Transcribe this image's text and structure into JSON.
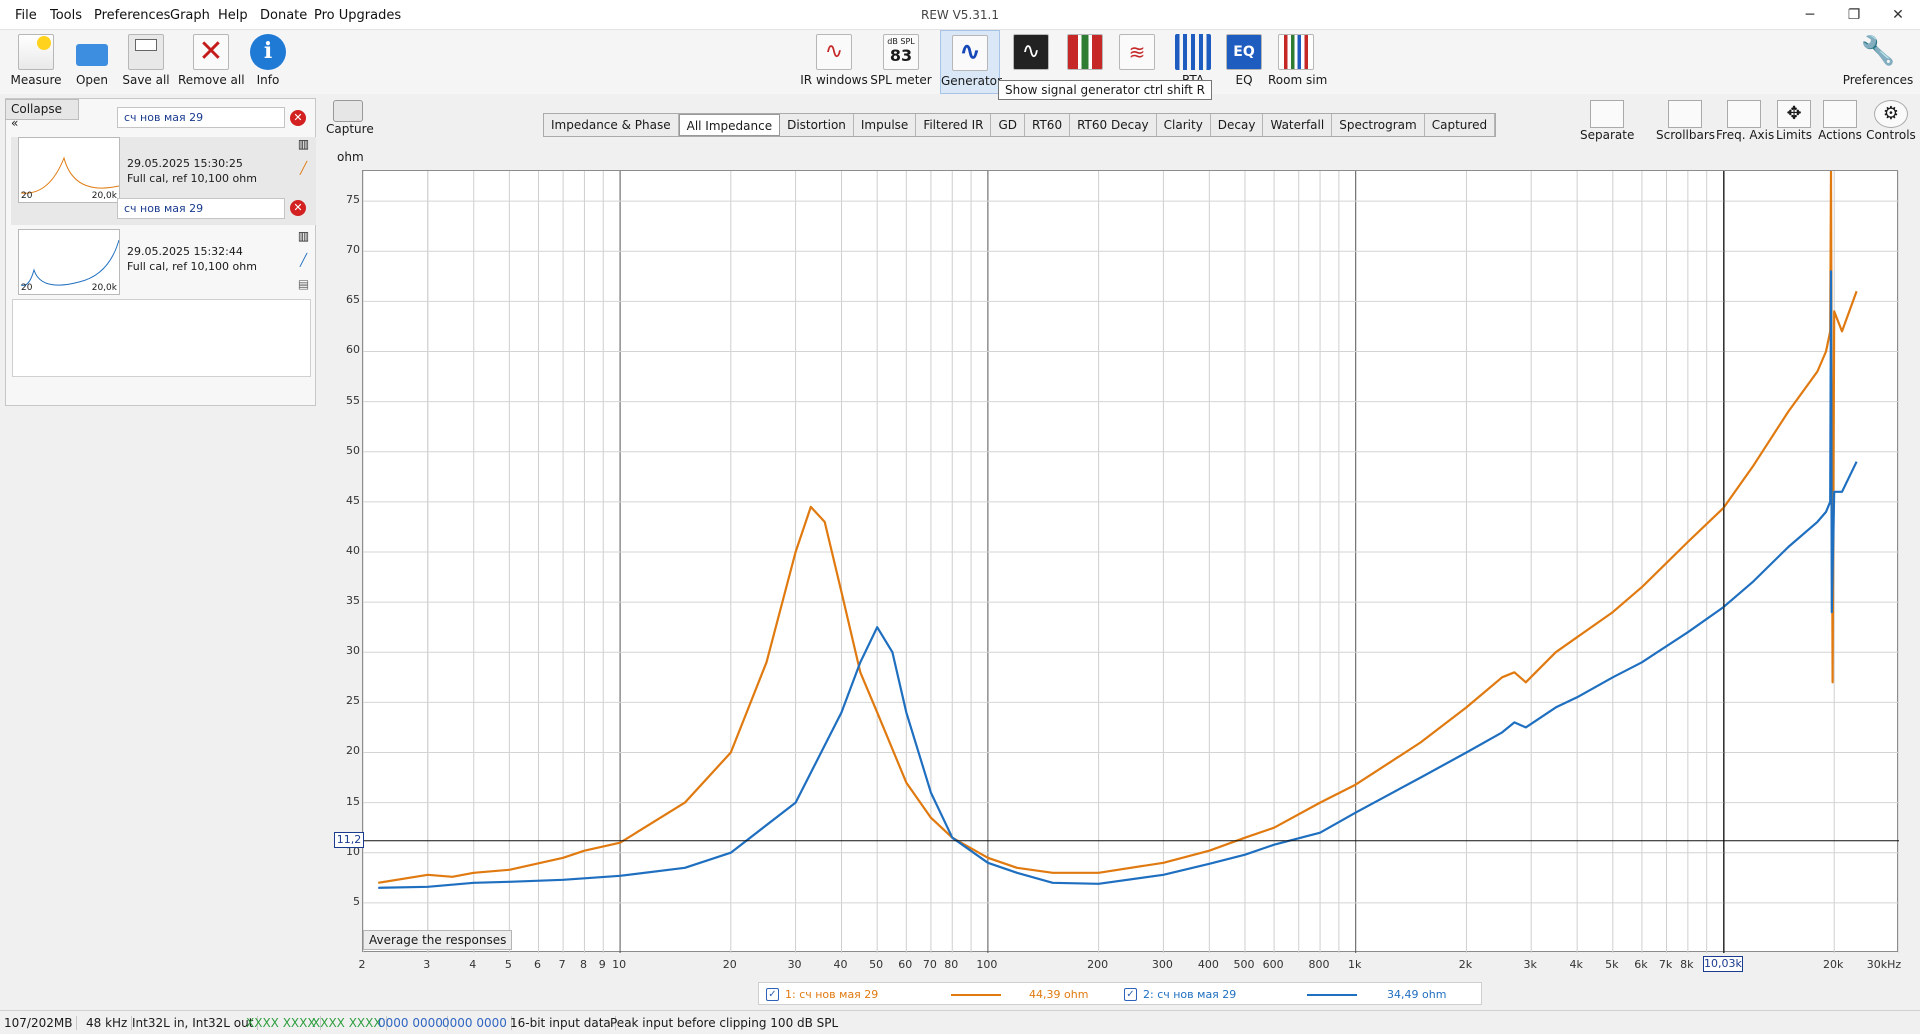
{
  "window": {
    "title": "REW V5.31.1",
    "menu": [
      "File",
      "Tools",
      "Preferences",
      "Graph",
      "Help",
      "Donate",
      "Pro Upgrades"
    ],
    "controls": {
      "minimize": "─",
      "maximize": "❐",
      "close": "✕"
    }
  },
  "toolbar": {
    "left": [
      {
        "label": "Measure",
        "icon": "measure-icon"
      },
      {
        "label": "Open",
        "icon": "folder-icon"
      },
      {
        "label": "Save all",
        "icon": "save-icon"
      },
      {
        "label": "Remove all",
        "icon": "remove-icon"
      },
      {
        "label": "Info",
        "icon": "info-icon"
      }
    ],
    "center": [
      {
        "label": "IR windows",
        "icon": "ir-windows-icon"
      },
      {
        "label": "SPL meter",
        "icon": "spl-meter-icon",
        "display": "83",
        "display_unit": "dB SPL"
      },
      {
        "label": "Generator",
        "icon": "generator-icon"
      },
      {
        "label": "",
        "icon": "scope-icon"
      },
      {
        "label": "",
        "icon": "levels-icon"
      },
      {
        "label": "",
        "icon": "spectrum-icon"
      },
      {
        "label": "RTA",
        "icon": "rta-icon"
      },
      {
        "label": "EQ",
        "icon": "eq-icon"
      },
      {
        "label": "Room sim",
        "icon": "room-sim-icon"
      }
    ],
    "right": {
      "label": "Preferences",
      "icon": "wrench-icon"
    }
  },
  "tooltip": "Show signal generator  ctrl shift R",
  "measurements": {
    "collapse_label": "Collapse",
    "items": [
      {
        "index": "1",
        "name": "сч нов мая 29",
        "date": "29.05.2025 15:30:25",
        "note": "Full cal, ref 10,100 ohm",
        "thumb_min": "20",
        "thumb_max": "20,0k",
        "color": "#e07a10"
      },
      {
        "index": "2",
        "name": "сч нов мая 29",
        "date": "29.05.2025 15:32:44",
        "note": "Full cal, ref 10,100 ohm",
        "thumb_min": "20",
        "thumb_max": "20,0k",
        "color": "#1f6fc0"
      }
    ]
  },
  "capture_label": "Capture",
  "graph_tabs": [
    "Impedance & Phase",
    "All Impedance",
    "Distortion",
    "Impulse",
    "Filtered IR",
    "GD",
    "RT60",
    "RT60 Decay",
    "Clarity",
    "Decay",
    "Waterfall",
    "Spectrogram",
    "Captured"
  ],
  "graph_tab_selected": "All Impedance",
  "right_tools": [
    {
      "label": "Separate",
      "icon": "separate-icon"
    },
    {
      "label": "Scrollbars",
      "icon": "scrollbars-icon"
    },
    {
      "label": "Freq. Axis",
      "icon": "freq-axis-icon"
    },
    {
      "label": "Limits",
      "icon": "limits-icon"
    },
    {
      "label": "Actions",
      "icon": "actions-icon"
    },
    {
      "label": "Controls",
      "icon": "controls-icon"
    }
  ],
  "average_label": "Average the responses",
  "chart_data": {
    "type": "line",
    "ylabel": "ohm",
    "xscale": "log",
    "xlim": [
      2,
      30000
    ],
    "ylim": [
      0,
      78
    ],
    "grid": true,
    "y_ticks": [
      5,
      10,
      15,
      20,
      25,
      30,
      35,
      40,
      45,
      50,
      55,
      60,
      65,
      70,
      75
    ],
    "x_ticks": [
      {
        "v": 2,
        "t": "2"
      },
      {
        "v": 3,
        "t": "3"
      },
      {
        "v": 4,
        "t": "4"
      },
      {
        "v": 5,
        "t": "5"
      },
      {
        "v": 6,
        "t": "6"
      },
      {
        "v": 7,
        "t": "7"
      },
      {
        "v": 8,
        "t": "8"
      },
      {
        "v": 9,
        "t": "9"
      },
      {
        "v": 10,
        "t": "10"
      },
      {
        "v": 20,
        "t": "20"
      },
      {
        "v": 30,
        "t": "30"
      },
      {
        "v": 40,
        "t": "40"
      },
      {
        "v": 50,
        "t": "50"
      },
      {
        "v": 60,
        "t": "60"
      },
      {
        "v": 70,
        "t": "70"
      },
      {
        "v": 80,
        "t": "80"
      },
      {
        "v": 100,
        "t": "100"
      },
      {
        "v": 200,
        "t": "200"
      },
      {
        "v": 300,
        "t": "300"
      },
      {
        "v": 400,
        "t": "400"
      },
      {
        "v": 500,
        "t": "500"
      },
      {
        "v": 600,
        "t": "600"
      },
      {
        "v": 800,
        "t": "800"
      },
      {
        "v": 1000,
        "t": "1k"
      },
      {
        "v": 2000,
        "t": "2k"
      },
      {
        "v": 3000,
        "t": "3k"
      },
      {
        "v": 4000,
        "t": "4k"
      },
      {
        "v": 5000,
        "t": "5k"
      },
      {
        "v": 6000,
        "t": "6k"
      },
      {
        "v": 7000,
        "t": "7k"
      },
      {
        "v": 8000,
        "t": "8k"
      },
      {
        "v": 20000,
        "t": "20k"
      },
      {
        "v": 30000,
        "t": "30kHz"
      }
    ],
    "cursor": {
      "x": 10030,
      "y": 11.2,
      "x_label": "10,03k",
      "y_label": "11,2"
    },
    "series": [
      {
        "name": "1: сч нов мая 29",
        "color": "#e07a10",
        "cursor_value": "44,39 ohm",
        "x": [
          2.2,
          3,
          3.5,
          4,
          5,
          7,
          8,
          10,
          15,
          20,
          25,
          30,
          33,
          36,
          40,
          45,
          50,
          60,
          70,
          80,
          100,
          120,
          150,
          200,
          300,
          400,
          500,
          600,
          800,
          1000,
          1500,
          2000,
          2500,
          2700,
          2900,
          3500,
          4000,
          5000,
          6000,
          8000,
          10000,
          12000,
          15000,
          18000,
          19000,
          19500,
          19600,
          19800,
          20000,
          21000,
          23000
        ],
        "y": [
          7,
          7.8,
          7.6,
          8,
          8.3,
          9.5,
          10.2,
          11,
          15,
          20,
          29,
          40,
          44.5,
          43,
          36,
          28,
          24,
          17,
          13.5,
          11.5,
          9.5,
          8.5,
          8,
          8,
          9,
          10.2,
          11.5,
          12.5,
          15,
          16.8,
          21,
          24.5,
          27.5,
          28,
          27,
          30,
          31.5,
          34,
          36.5,
          41,
          44.4,
          48.5,
          54,
          58,
          60,
          62,
          78,
          27,
          64,
          62,
          66
        ]
      },
      {
        "name": "2: сч нов мая 29",
        "color": "#1f6fc0",
        "cursor_value": "34,49 ohm",
        "x": [
          2.2,
          3,
          4,
          5,
          7,
          10,
          15,
          20,
          30,
          40,
          45,
          50,
          55,
          60,
          70,
          80,
          100,
          120,
          150,
          200,
          300,
          400,
          500,
          600,
          800,
          1000,
          1500,
          2000,
          2500,
          2700,
          2900,
          3500,
          4000,
          5000,
          6000,
          8000,
          10000,
          12000,
          15000,
          18000,
          19000,
          19500,
          19600,
          19700,
          20000,
          21000,
          23000
        ],
        "y": [
          6.5,
          6.6,
          7,
          7.1,
          7.3,
          7.7,
          8.5,
          10,
          15,
          24,
          29,
          32.5,
          30,
          24,
          16,
          11.5,
          9,
          8,
          7,
          6.9,
          7.8,
          8.9,
          9.8,
          10.8,
          12,
          14,
          17.5,
          20,
          22,
          23,
          22.5,
          24.5,
          25.5,
          27.5,
          29,
          32,
          34.5,
          37,
          40.5,
          43,
          44,
          45,
          68,
          34,
          46,
          46,
          49
        ]
      }
    ]
  },
  "status": [
    "107/202MB",
    "48 kHz",
    "Int32L in, Int32L out",
    "XXXX XXXX",
    "XXXX XXXX",
    "0000 0000",
    "0000 0000",
    "16-bit input data",
    "Peak input before clipping 100 dB SPL"
  ]
}
